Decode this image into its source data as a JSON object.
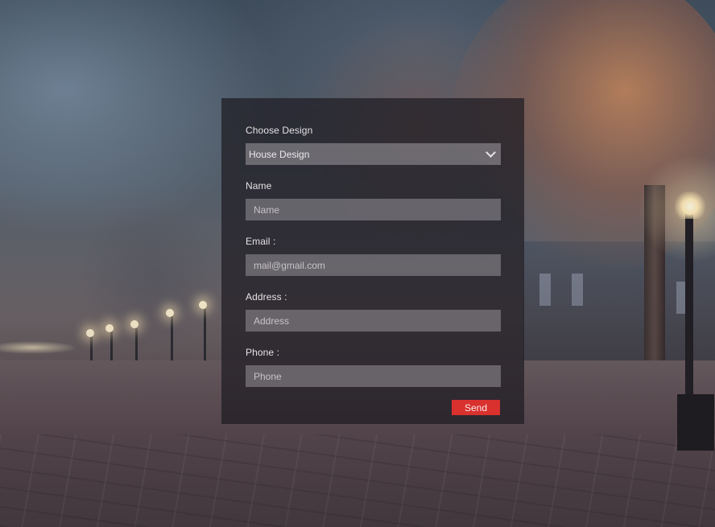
{
  "form": {
    "design": {
      "label": "Choose Design",
      "selected": "House Design"
    },
    "name": {
      "label": "Name",
      "placeholder": "Name",
      "value": ""
    },
    "email": {
      "label": "Email :",
      "placeholder": "mail@gmail.com",
      "value": ""
    },
    "address": {
      "label": "Address :",
      "placeholder": "Address",
      "value": ""
    },
    "phone": {
      "label": "Phone :",
      "placeholder": "Phone",
      "value": ""
    },
    "send_label": "Send"
  },
  "colors": {
    "send_button": "#d9312e",
    "panel": "#1e1c22",
    "input": "#969298"
  },
  "icons": {
    "select_arrow": "chevron-down-icon"
  }
}
